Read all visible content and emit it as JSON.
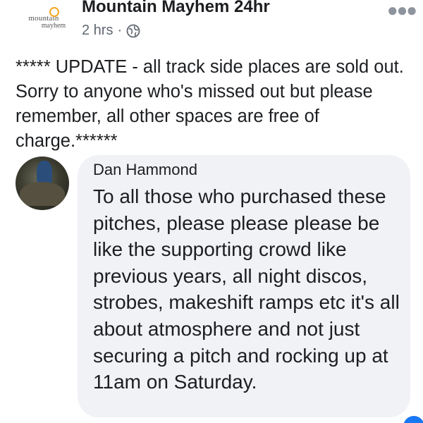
{
  "post": {
    "page_name": "Mountain Mayhem 24hr",
    "time": "2 hrs",
    "separator": "·",
    "logo": {
      "line1": "mountain",
      "line2": "mayhem"
    },
    "text": "***** UPDATE - all track side places are sold out. Sorry to anyone who's missed out but please remember, all other spaces are free of charge.******"
  },
  "comment": {
    "author": "Dan Hammond",
    "text": "To all those who purchased these pitches, please please please be like the supporting crowd like previous years, all night discos, strobes, makeshift ramps etc it's all about atmosphere and not just securing a pitch and rocking up at 11am on Saturday."
  },
  "icons": {
    "more": "more-options-icon",
    "privacy": "globe-icon"
  },
  "colors": {
    "text": "#1c1e21",
    "meta": "#606770",
    "bubble": "#f0f2f5",
    "logo_accent": "#f5a623"
  }
}
